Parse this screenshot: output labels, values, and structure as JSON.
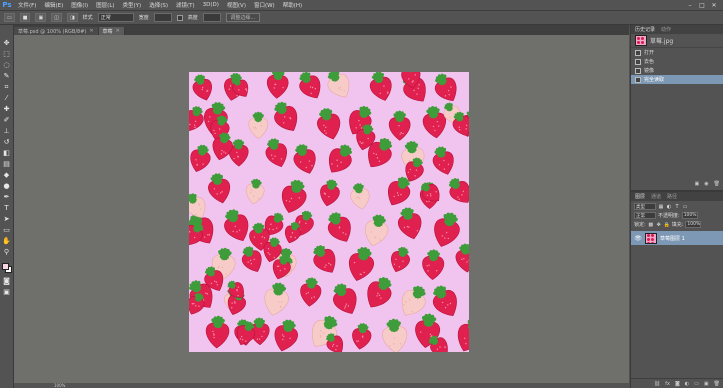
{
  "app": {
    "logo": "Ps"
  },
  "menu": [
    "文件(F)",
    "编辑(E)",
    "图像(I)",
    "图层(L)",
    "类型(Y)",
    "选择(S)",
    "滤镜(T)",
    "3D(D)",
    "视图(V)",
    "窗口(W)",
    "帮助(H)"
  ],
  "options": {
    "style_label": "样式",
    "style_value": "正常",
    "width_label": "宽度",
    "height_label": "高度",
    "refine_edge": "调整边缘..."
  },
  "tabs": [
    {
      "label": "草莓.psd @ 100% (RGB/8#)",
      "active": false
    },
    {
      "label": "草莓",
      "active": true
    }
  ],
  "history_panel": {
    "tabs": [
      "历史记录",
      "动作"
    ],
    "snapshot_label": "草莓.jpg",
    "items": [
      "打开",
      "去色",
      "镜像",
      "完全读取"
    ]
  },
  "layers_panel": {
    "tabs": [
      "图层",
      "通道",
      "路径"
    ],
    "kind_label": "类型",
    "blend_mode": "正常",
    "opacity_label": "不透明度:",
    "opacity_value": "100%",
    "lock_label": "锁定:",
    "fill_label": "填充:",
    "fill_value": "100%",
    "layer_name": "草莓图层 1"
  },
  "status": {
    "zoom": "100%"
  },
  "colors": {
    "canvas_bg": "#f0c4ee",
    "strawberry_red": "#e0204f",
    "strawberry_pale": "#f7cbc8",
    "leaf_green": "#3f9c3a",
    "selection_blue": "#7d98b4",
    "workspace": "#6f6f6c"
  },
  "icons": [
    "move-icon",
    "marquee-icon",
    "lasso-icon",
    "quick-select-icon",
    "crop-icon",
    "eyedropper-icon",
    "healing-icon",
    "brush-icon",
    "stamp-icon",
    "history-brush-icon",
    "eraser-icon",
    "gradient-icon",
    "blur-icon",
    "dodge-icon",
    "pen-icon",
    "type-icon",
    "path-select-icon",
    "shape-icon",
    "hand-icon",
    "zoom-icon"
  ]
}
